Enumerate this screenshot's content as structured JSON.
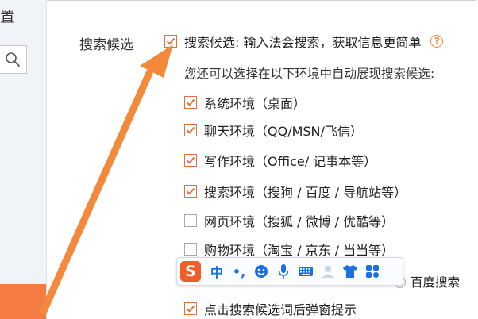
{
  "left_panel": {
    "title_fragment": "置"
  },
  "section": {
    "label": "搜索候选"
  },
  "main_option": {
    "label": "搜索候选: 输入法会搜索，获取信息更简单",
    "checked": true,
    "help_glyph": "?"
  },
  "description": "您还可以选择在以下环境中自动展现搜索候选:",
  "options": [
    {
      "label": "系统环境（桌面）",
      "checked": true
    },
    {
      "label": "聊天环境（QQ/MSN/飞信）",
      "checked": true
    },
    {
      "label": "写作环境（Office/ 记事本等）",
      "checked": true
    },
    {
      "label": "搜索环境（搜狗 / 百度 / 导航站等）",
      "checked": true
    },
    {
      "label": "网页环境（搜狐 / 微博 / 优酷等）",
      "checked": false
    },
    {
      "label": "购物环境（淘宝 / 京东 / 当当等）",
      "checked": false
    }
  ],
  "engine_option": {
    "label": "百度搜索",
    "selected": false
  },
  "popup_option": {
    "label": "点击搜索候选词后弹窗提示",
    "checked": true
  },
  "ime_toolbar": {
    "logo": "S",
    "mode": "中",
    "punct": "•,",
    "icons": [
      "emoji-icon",
      "microphone-icon",
      "keyboard-icon",
      "user-icon",
      "skin-icon",
      "toolbox-icon"
    ]
  },
  "colors": {
    "accent": "#f47b43",
    "checkbox": "#e0703c",
    "ime_blue": "#1c6fe0"
  }
}
